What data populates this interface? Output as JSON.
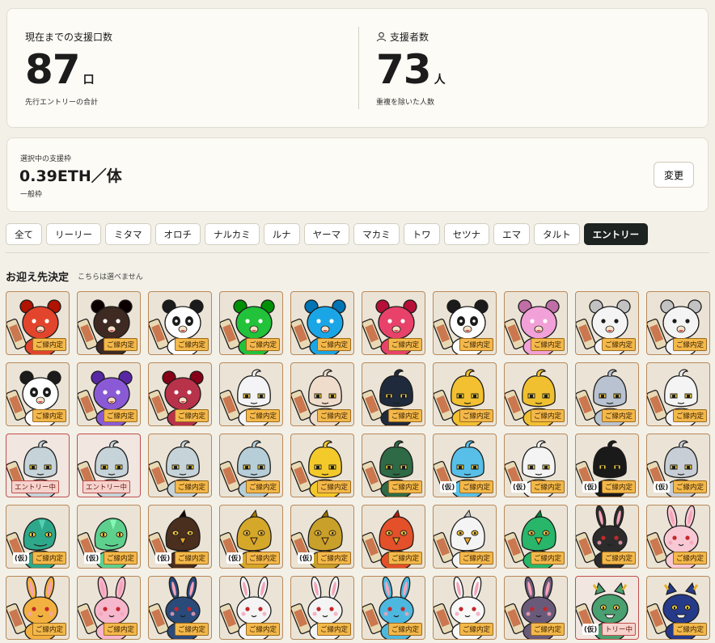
{
  "stats": {
    "total": {
      "label": "現在までの支援口数",
      "value": "87",
      "unit": "口",
      "sub": "先行エントリーの合計"
    },
    "supporters": {
      "label": "支援者数",
      "icon": "user-icon",
      "value": "73",
      "unit": "人",
      "sub": "重複を除いた人数"
    }
  },
  "selected": {
    "label": "選択中の支援枠",
    "value": "0.39ETH／体",
    "sub": "一般枠",
    "change_label": "変更"
  },
  "tabs": [
    {
      "label": "全て",
      "active": false
    },
    {
      "label": "リーリー",
      "active": false
    },
    {
      "label": "ミタマ",
      "active": false
    },
    {
      "label": "オロチ",
      "active": false
    },
    {
      "label": "ナルカミ",
      "active": false
    },
    {
      "label": "ルナ",
      "active": false
    },
    {
      "label": "ヤーマ",
      "active": false
    },
    {
      "label": "マカミ",
      "active": false
    },
    {
      "label": "トワ",
      "active": false
    },
    {
      "label": "セツナ",
      "active": false
    },
    {
      "label": "エマ",
      "active": false
    },
    {
      "label": "タルト",
      "active": false
    },
    {
      "label": "エントリー",
      "active": true
    }
  ],
  "section": {
    "title": "お迎え先決定",
    "note": "こちらは選べません"
  },
  "tmp_label": "(仮)",
  "items": [
    {
      "kind": "bear",
      "color": "#e2452b",
      "badge": "ご縁内定"
    },
    {
      "kind": "bear",
      "color": "#3e2a22",
      "badge": "ご縁内定"
    },
    {
      "kind": "panda",
      "color": "#ffffff",
      "badge": "ご縁内定"
    },
    {
      "kind": "bear",
      "color": "#22c23a",
      "badge": "ご縁内定"
    },
    {
      "kind": "bear",
      "color": "#1aa6e6",
      "badge": "ご縁内定"
    },
    {
      "kind": "bear",
      "color": "#e8426a",
      "badge": "ご縁内定"
    },
    {
      "kind": "panda",
      "color": "#ffffff",
      "badge": "ご縁内定"
    },
    {
      "kind": "bear",
      "color": "#f2a0d8",
      "badge": "ご縁内定"
    },
    {
      "kind": "bear",
      "color": "#f4f4f4",
      "badge": "ご縁内定"
    },
    {
      "kind": "bear",
      "color": "#f4f4f4",
      "badge": "ご縁内定"
    },
    {
      "kind": "panda",
      "color": "#ffffff",
      "badge": "ご縁内定"
    },
    {
      "kind": "bear",
      "color": "#8a5ad6",
      "badge": "ご縁内定"
    },
    {
      "kind": "bear",
      "color": "#b8324a",
      "badge": "ご縁内定"
    },
    {
      "kind": "ghost",
      "color": "#f4f4f6",
      "badge": "ご縁内定"
    },
    {
      "kind": "ghost",
      "color": "#f0dccb",
      "badge": "ご縁内定"
    },
    {
      "kind": "ghost",
      "color": "#1f2a3c",
      "badge": "ご縁内定"
    },
    {
      "kind": "ghost",
      "color": "#f2c030",
      "badge": "ご縁内定"
    },
    {
      "kind": "ghost",
      "color": "#f0c030",
      "badge": "ご縁内定"
    },
    {
      "kind": "ghost",
      "color": "#b8c2d0",
      "badge": "ご縁内定"
    },
    {
      "kind": "ghost",
      "color": "#f4f4f4",
      "badge": "ご縁内定"
    },
    {
      "kind": "ghost",
      "color": "#c6d4da",
      "badge": "エントリー中",
      "entry": true
    },
    {
      "kind": "ghost",
      "color": "#c6d4da",
      "badge": "エントリー中",
      "entry": true
    },
    {
      "kind": "ghost",
      "color": "#c6d4da",
      "badge": "ご縁内定"
    },
    {
      "kind": "ghost",
      "color": "#b6ced8",
      "badge": "ご縁内定"
    },
    {
      "kind": "ghost",
      "color": "#f4c92a",
      "badge": "ご縁内定"
    },
    {
      "kind": "ghost",
      "color": "#2e6a46",
      "badge": "ご縁内定"
    },
    {
      "kind": "ghost",
      "color": "#58c0e8",
      "badge": "ご縁内定",
      "tmp": true
    },
    {
      "kind": "ghost",
      "color": "#f4f4f4",
      "badge": "ご縁内定",
      "tmp": true
    },
    {
      "kind": "ghost",
      "color": "#1a1a1a",
      "badge": "ご縁内定",
      "tmp": true
    },
    {
      "kind": "ghost",
      "color": "#c8ced6",
      "badge": "ご縁内定",
      "tmp": true
    },
    {
      "kind": "snake",
      "color": "#2ea88a",
      "badge": "ご縁内定",
      "tmp": true
    },
    {
      "kind": "snake",
      "color": "#5ed08e",
      "badge": "ご縁内定",
      "tmp": true
    },
    {
      "kind": "bird",
      "color": "#4a2e1e",
      "badge": "ご縁内定",
      "tmp": true
    },
    {
      "kind": "bird",
      "color": "#d6a82a",
      "badge": "ご縁内定",
      "tmp": true
    },
    {
      "kind": "bird",
      "color": "#c8a02a",
      "badge": "ご縁内定",
      "tmp": true
    },
    {
      "kind": "bird",
      "color": "#e4502a",
      "badge": "ご縁内定"
    },
    {
      "kind": "bird",
      "color": "#f4f4f4",
      "badge": "ご縁内定"
    },
    {
      "kind": "bird",
      "color": "#28b66a",
      "badge": "ご縁内定"
    },
    {
      "kind": "rabbit",
      "color": "#2c2c2c",
      "badge": "ご縁内定"
    },
    {
      "kind": "rabbit",
      "color": "#f8c8d4",
      "badge": "ご縁内定"
    },
    {
      "kind": "rabbit",
      "color": "#f2b040",
      "badge": "ご縁内定"
    },
    {
      "kind": "rabbit",
      "color": "#f6b6cc",
      "badge": "ご縁内定"
    },
    {
      "kind": "rabbit",
      "color": "#2a4a7a",
      "badge": "ご縁内定"
    },
    {
      "kind": "rabbit",
      "color": "#f4f4f4",
      "badge": "ご縁内定"
    },
    {
      "kind": "rabbit",
      "color": "#f4f4f4",
      "badge": "ご縁内定"
    },
    {
      "kind": "rabbit",
      "color": "#4cb8e0",
      "badge": "ご縁内定"
    },
    {
      "kind": "rabbit",
      "color": "#f8f8f8",
      "badge": "ご縁内定"
    },
    {
      "kind": "rabbit",
      "color": "#6a5a7a",
      "badge": "ご縁内定"
    },
    {
      "kind": "cat",
      "color": "#4aa070",
      "badge": "トリー中",
      "entry": true,
      "tmp": true
    },
    {
      "kind": "cat",
      "color": "#263a8a",
      "badge": "ご縁内定"
    }
  ]
}
